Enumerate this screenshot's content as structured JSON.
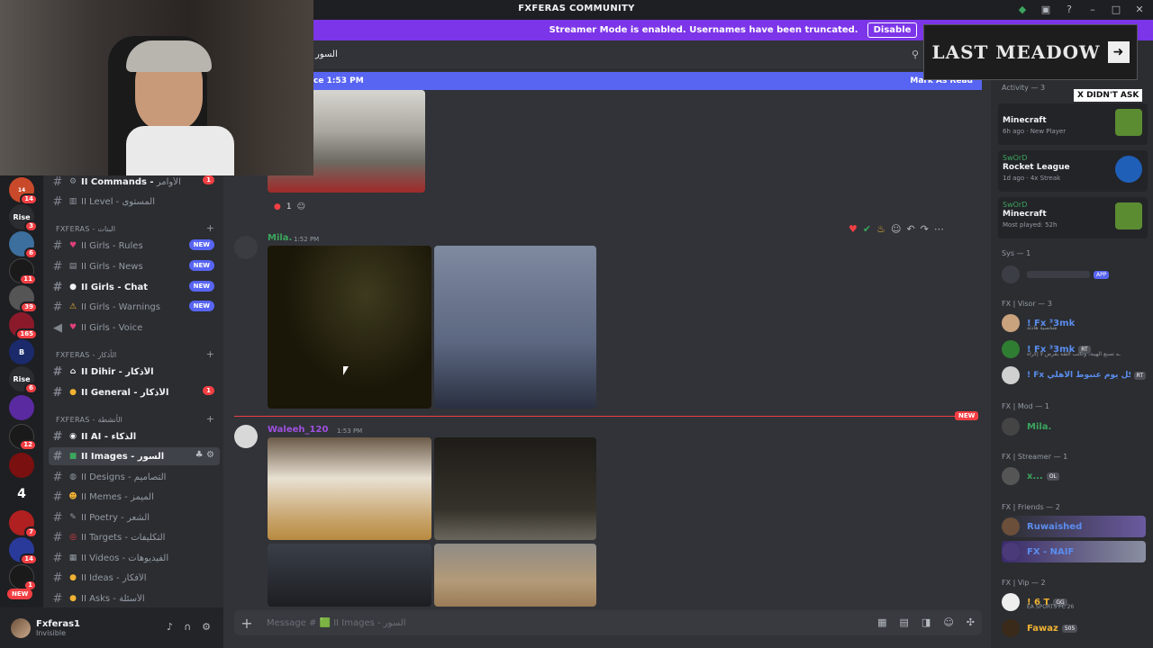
{
  "window": {
    "title": "FXFERAS COMMUNITY"
  },
  "banner": {
    "text": "Streamer Mode is enabled. Usernames have been truncated.",
    "button": "Disable",
    "color": "#7c35e8"
  },
  "chat": {
    "channel_title": "السور",
    "new_since": "ce 1:53 PM",
    "mark_read": "Mark As Read",
    "reaction_count": "1",
    "messages": [
      {
        "author": "Mila.",
        "time": "1:52 PM",
        "author_color": "#3ba55d"
      },
      {
        "author": "Waleeh_120",
        "time": "1:53 PM",
        "author_color": "#a050e0"
      }
    ],
    "new_tag": "NEW",
    "input_placeholder": "Message # 🟩 II Images - السور"
  },
  "servers": [
    {
      "label": "14",
      "color": "#c94a2a",
      "badge": "14"
    },
    {
      "label": "Rise",
      "color": "#2b2d31",
      "badge": "3"
    },
    {
      "label": "",
      "color": "#3c6e9e",
      "badge": "6"
    },
    {
      "label": "",
      "color": "#1a1a1a",
      "badge": "11"
    },
    {
      "label": "",
      "color": "#555",
      "badge": "39"
    },
    {
      "label": "",
      "color": "#8a1a2a",
      "badge": "165"
    },
    {
      "label": "B",
      "color": "#1a2a6a",
      "badge": ""
    },
    {
      "label": "Rise",
      "color": "#2b2d31",
      "badge": "6"
    },
    {
      "label": "",
      "color": "#5a2aa0",
      "badge": ""
    },
    {
      "label": "",
      "color": "#1a1a1a",
      "badge": "12"
    },
    {
      "label": "",
      "color": "#7a1010",
      "badge": ""
    },
    {
      "label": "4",
      "color": "#1e1f22",
      "badge": ""
    },
    {
      "label": "",
      "color": "#b02020",
      "badge": "7"
    },
    {
      "label": "",
      "color": "#2a3a9a",
      "badge": "14"
    },
    {
      "label": "",
      "color": "#1a1a1a",
      "badge": "1"
    }
  ],
  "new_server_pill": "NEW",
  "channels": {
    "top": [
      {
        "emoji": "⚙",
        "bold": "II Commands -",
        "ar": "الأوامر",
        "right": "1",
        "right_type": "count"
      },
      {
        "emoji": "📊",
        "bold": "",
        "name": "II Level -",
        "ar": "المستوى",
        "right": "",
        "right_type": ""
      }
    ],
    "cat1": "FXFERAS - البنات",
    "girls": [
      {
        "emoji": "💗",
        "name": "II Girls - Rules",
        "right": "NEW"
      },
      {
        "emoji": "📰",
        "name": "II Girls - News",
        "right": "NEW"
      },
      {
        "emoji": "💬",
        "name": "II Girls - Chat",
        "right": "NEW",
        "bold": true
      },
      {
        "emoji": "⚠",
        "name": "II Girls - Warnings",
        "right": "NEW"
      },
      {
        "emoji": "💗",
        "name": "II Girls - Voice",
        "right": "",
        "voice": true
      }
    ],
    "cat2": "FXFERAS - الأذكار",
    "azkar": [
      {
        "emoji": "🕌",
        "name": "II Dihir -",
        "ar": "الأذكار",
        "right": ""
      },
      {
        "emoji": "💡",
        "name": "II General -",
        "ar": "الأذكار",
        "right": "1"
      }
    ],
    "cat3": "FXFERAS - الأنشطة",
    "activities": [
      {
        "emoji": "🤖",
        "name": "II AI -",
        "ar": "الذكاء",
        "active": false
      },
      {
        "emoji": "🟩",
        "name": "II Images -",
        "ar": "السور",
        "active": true
      },
      {
        "emoji": "🎨",
        "name": "II Designs -",
        "ar": "التصاميم",
        "active": false
      },
      {
        "emoji": "😂",
        "name": "II Memes -",
        "ar": "الميمز",
        "active": false
      },
      {
        "emoji": "✍",
        "name": "II Poetry -",
        "ar": "الشعر",
        "active": false
      },
      {
        "emoji": "🎯",
        "name": "II Targets -",
        "ar": "التكليفات",
        "active": false
      },
      {
        "emoji": "🎬",
        "name": "II Videos -",
        "ar": "الفيديوهات",
        "active": false
      },
      {
        "emoji": "💡",
        "name": "II Ideas -",
        "ar": "الأفكار",
        "active": false
      },
      {
        "emoji": "💡",
        "name": "II Asks -",
        "ar": "الأسئلة",
        "active": false
      }
    ]
  },
  "user": {
    "name": "Fxferas1",
    "status": "Invisible"
  },
  "members": {
    "activity_header": "Activity — 3",
    "activities": [
      {
        "user": "",
        "game": "Minecraft",
        "meta": "6h ago · New Player",
        "icon_color": "#5b8c32"
      },
      {
        "user": "SwOrD",
        "game": "Rocket League",
        "meta": "1d ago · 4x Streak",
        "icon_color": "#1f5fb8"
      },
      {
        "user": "SwOrD",
        "game": "Minecraft",
        "meta": "Most played: 52h",
        "icon_color": "#5b8c32"
      }
    ],
    "groups": [
      {
        "title": "Sys — 1",
        "items": [
          {
            "name": "",
            "color": "#3b5bdb",
            "tag": "APP",
            "av": "#2b2d31"
          }
        ]
      },
      {
        "title": "FX | Visor — 3",
        "items": [
          {
            "name": "! Fx ³3mk",
            "color": "#5a8dee",
            "sub": "شخصية هادئة",
            "av": "#c9a27e",
            "tag": ""
          },
          {
            "name": "! Fx ³3mk",
            "color": "#5a8dee",
            "sub": "ـه تصنع الهيبة، وتكتب الثقة بقرض لا إكراه",
            "av": "#2f7d32",
            "tag": "RT"
          },
          {
            "name": "! Fx كل يوم عنبوط الأهلي",
            "color": "#5a8dee",
            "sub": "",
            "av": "#d0d0d0",
            "tag": "RT"
          }
        ]
      },
      {
        "title": "FX | Mod — 1",
        "items": [
          {
            "name": "Mila.",
            "color": "#3ba55d",
            "sub": "",
            "av": "#444",
            "tag": ""
          }
        ]
      },
      {
        "title": "FX | Streamer — 1",
        "items": [
          {
            "name": "x...",
            "color": "#3ba55d",
            "sub": "",
            "av": "#555",
            "tag": "OL"
          }
        ]
      },
      {
        "title": "FX | Friends — 2",
        "items": [
          {
            "name": "Ruwaished",
            "color": "#5a8dee",
            "sub": "",
            "av": "#6b4f3a",
            "tag": ""
          },
          {
            "name": "FX - NAIF",
            "color": "#5a8dee",
            "sub": "",
            "av": "#4b3a7a",
            "tag": ""
          }
        ]
      },
      {
        "title": "FX | Vip — 2",
        "items": [
          {
            "name": "! 6 T",
            "color": "#f0b232",
            "sub": "EA SPORTS FC 26",
            "av": "#eee",
            "tag": "GG"
          },
          {
            "name": "Fawaz",
            "color": "#f0b232",
            "sub": "",
            "av": "#3a2a1a",
            "tag": "505"
          }
        ]
      }
    ]
  },
  "overlay": {
    "logo_text": "LAST MEADOW",
    "label": "X DIDN'T ASK"
  }
}
